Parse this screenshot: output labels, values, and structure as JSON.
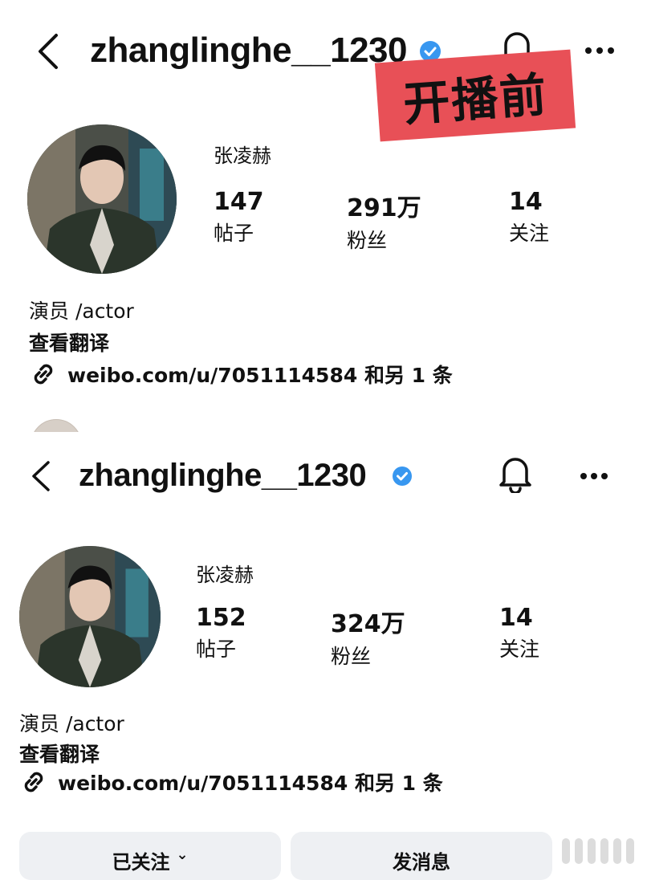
{
  "label_banner": "开播前",
  "before": {
    "username": "zhanglinghe__1230",
    "display_name": "张凌赫",
    "stats": [
      {
        "value": "147",
        "label": "帖子"
      },
      {
        "value": "291万",
        "label": "粉丝"
      },
      {
        "value": "14",
        "label": "关注"
      }
    ],
    "bio": "演员 /actor",
    "translate": "查看翻译",
    "link": "weibo.com/u/7051114584 和另 1 条"
  },
  "after": {
    "username": "zhanglinghe__1230",
    "display_name": "张凌赫",
    "stats": [
      {
        "value": "152",
        "label": "帖子"
      },
      {
        "value": "324万",
        "label": "粉丝"
      },
      {
        "value": "14",
        "label": "关注"
      }
    ],
    "bio": "演员 /actor",
    "translate": "查看翻译",
    "link": "weibo.com/u/7051114584 和另 1 条",
    "buttons": {
      "following": "已关注",
      "message": "发消息"
    }
  },
  "colors": {
    "verified": "#3897f0",
    "banner": "#e85057",
    "button_bg": "#eef0f3"
  },
  "icons": [
    "back-icon",
    "verified-icon",
    "bell-icon",
    "more-icon",
    "link-icon",
    "chevron-down-icon"
  ]
}
